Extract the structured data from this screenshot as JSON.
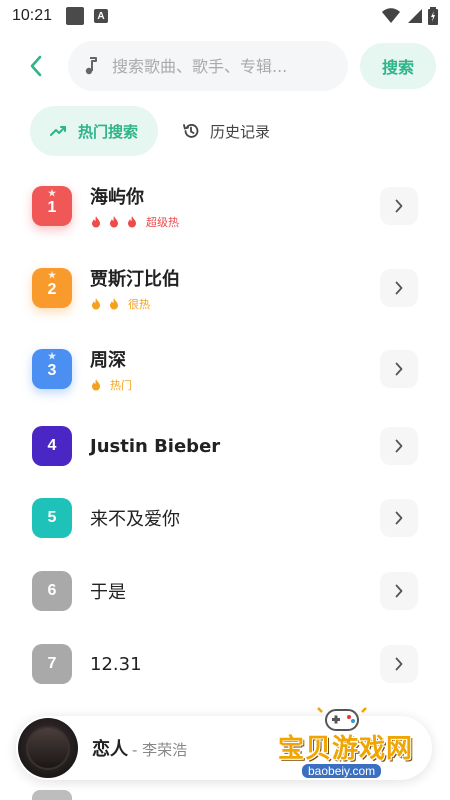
{
  "status_bar": {
    "time": "10:21",
    "notif_letter": "A"
  },
  "search": {
    "placeholder": "搜索歌曲、歌手、专辑...",
    "button_label": "搜索"
  },
  "tabs": [
    {
      "label": "热门搜索",
      "active": true,
      "icon": "trending-icon"
    },
    {
      "label": "历史记录",
      "active": false,
      "icon": "history-icon"
    }
  ],
  "hot_list": [
    {
      "rank": "1",
      "title": "海屿你",
      "heat": "超级热",
      "flames": 3,
      "color": "#f05757",
      "heat_color": "#ee4b4b"
    },
    {
      "rank": "2",
      "title": "贾斯汀比伯",
      "heat": "很热",
      "flames": 2,
      "color": "#f99a2d",
      "heat_color": "#f3a21f"
    },
    {
      "rank": "3",
      "title": "周深",
      "heat": "热门",
      "flames": 1,
      "color": "#4b8ff2",
      "heat_color": "#f3a21f"
    },
    {
      "rank": "4",
      "title": "Justin Bieber",
      "heat": "",
      "flames": 0,
      "color": "#4a27c4"
    },
    {
      "rank": "5",
      "title": "来不及爱你",
      "heat": "",
      "flames": 0,
      "color": "#1ec2b8"
    },
    {
      "rank": "6",
      "title": "于是",
      "heat": "",
      "flames": 0,
      "color": "#a9a9a9"
    },
    {
      "rank": "7",
      "title": "12.31",
      "heat": "",
      "flames": 0,
      "color": "#a9a9a9"
    }
  ],
  "player": {
    "title": "恋人",
    "artist": "- 李荣浩"
  },
  "watermark": {
    "text": "宝贝游戏网",
    "url": "baobeiy.com"
  },
  "colors": {
    "accent": "#2fb48a",
    "accent_bg": "#e6f6f0"
  }
}
